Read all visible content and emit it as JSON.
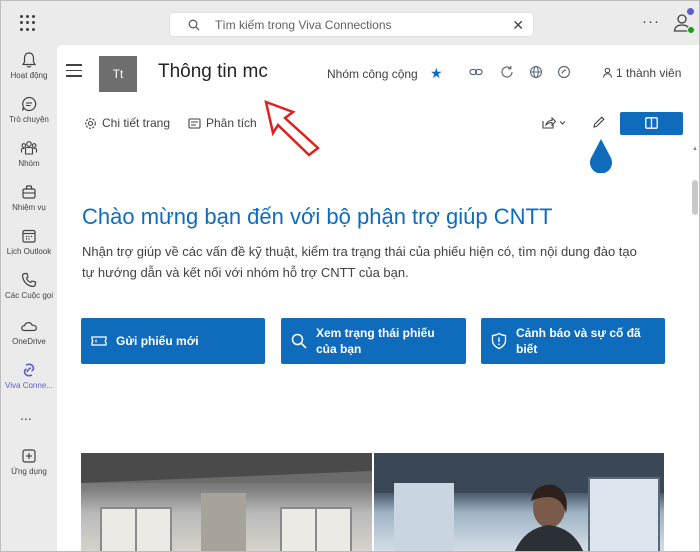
{
  "search": {
    "placeholder": "Tìm kiếm trong Viva Connections"
  },
  "rail": {
    "items": [
      {
        "label": "Hoạt động",
        "icon": "bell-icon"
      },
      {
        "label": "Trò chuyện",
        "icon": "chat-icon"
      },
      {
        "label": "Nhóm",
        "icon": "teams-icon"
      },
      {
        "label": "Nhiệm vụ",
        "icon": "briefcase-icon"
      },
      {
        "label": "Lịch Outlook",
        "icon": "calendar-icon"
      },
      {
        "label": "Các Cuộc gọi",
        "icon": "phone-icon"
      },
      {
        "label": "OneDrive",
        "icon": "cloud-icon"
      },
      {
        "label": "Viva Conne...",
        "icon": "viva-connections-icon"
      },
      {
        "label": "Ứng dụng",
        "icon": "add-apps-icon"
      }
    ],
    "more": "..."
  },
  "site": {
    "logo_text": "Tt",
    "title": "Thông tin mc",
    "group_type": "Nhóm công cộng",
    "members": "1 thành viên"
  },
  "commands": {
    "page_details": "Chi tiết trang",
    "analytics": "Phân tích"
  },
  "hero": {
    "headline": "Chào mừng bạn đến với bộ phận trợ giúp CNTT",
    "description": "Nhận trợ giúp về các vấn đề kỹ thuật, kiểm tra trạng thái của phiếu hiện có, tìm nội dung đào tạo tự hướng dẫn và kết nối với nhóm hỗ trợ CNTT của bạn."
  },
  "quick_links": [
    {
      "label": "Gửi phiếu mới",
      "icon": "ticket-icon"
    },
    {
      "label": "Xem trạng thái phiếu của bạn",
      "icon": "search-icon"
    },
    {
      "label": "Cảnh báo và sự cố đã biết",
      "icon": "shield-alert-icon"
    }
  ],
  "colors": {
    "accent": "#0f6cbd",
    "rail_active": "#5b5fc7",
    "annotation_arrow": "#e0201c"
  }
}
